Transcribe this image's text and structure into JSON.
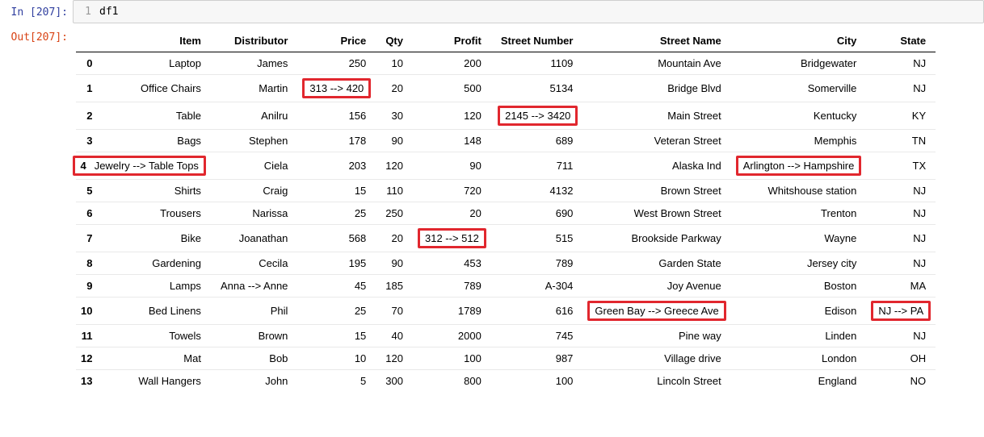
{
  "cell": {
    "in_prompt": "In [207]:",
    "out_prompt": "Out[207]:",
    "line_number": "1",
    "code": "df1"
  },
  "table": {
    "columns": [
      "Item",
      "Distributor",
      "Price",
      "Qty",
      "Profit",
      "Street Number",
      "Street Name",
      "City",
      "State"
    ],
    "rows": [
      {
        "idx": "0",
        "Item": "Laptop",
        "Distributor": "James",
        "Price": "250",
        "Qty": "10",
        "Profit": "200",
        "Street Number": "1109",
        "Street Name": "Mountain Ave",
        "City": "Bridgewater",
        "State": "NJ"
      },
      {
        "idx": "1",
        "Item": "Office Chairs",
        "Distributor": "Martin",
        "Price": "313 --> 420",
        "Qty": "20",
        "Profit": "500",
        "Street Number": "5134",
        "Street Name": "Bridge Blvd",
        "City": "Somerville",
        "State": "NJ"
      },
      {
        "idx": "2",
        "Item": "Table",
        "Distributor": "Anilru",
        "Price": "156",
        "Qty": "30",
        "Profit": "120",
        "Street Number": "2145 --> 3420",
        "Street Name": "Main Street",
        "City": "Kentucky",
        "State": "KY"
      },
      {
        "idx": "3",
        "Item": "Bags",
        "Distributor": "Stephen",
        "Price": "178",
        "Qty": "90",
        "Profit": "148",
        "Street Number": "689",
        "Street Name": "Veteran Street",
        "City": "Memphis",
        "State": "TN"
      },
      {
        "idx": "4",
        "Item": "Jewelry --> Table Tops",
        "Distributor": "Ciela",
        "Price": "203",
        "Qty": "120",
        "Profit": "90",
        "Street Number": "711",
        "Street Name": "Alaska Ind",
        "City": "Arlington --> Hampshire",
        "State": "TX"
      },
      {
        "idx": "5",
        "Item": "Shirts",
        "Distributor": "Craig",
        "Price": "15",
        "Qty": "110",
        "Profit": "720",
        "Street Number": "4132",
        "Street Name": "Brown Street",
        "City": "Whitshouse station",
        "State": "NJ"
      },
      {
        "idx": "6",
        "Item": "Trousers",
        "Distributor": "Narissa",
        "Price": "25",
        "Qty": "250",
        "Profit": "20",
        "Street Number": "690",
        "Street Name": "West Brown Street",
        "City": "Trenton",
        "State": "NJ"
      },
      {
        "idx": "7",
        "Item": "Bike",
        "Distributor": "Joanathan",
        "Price": "568",
        "Qty": "20",
        "Profit": "312 --> 512",
        "Street Number": "515",
        "Street Name": "Brookside Parkway",
        "City": "Wayne",
        "State": "NJ"
      },
      {
        "idx": "8",
        "Item": "Gardening",
        "Distributor": "Cecila",
        "Price": "195",
        "Qty": "90",
        "Profit": "453",
        "Street Number": "789",
        "Street Name": "Garden State",
        "City": "Jersey city",
        "State": "NJ"
      },
      {
        "idx": "9",
        "Item": "Lamps",
        "Distributor": "Anna --> Anne",
        "Price": "45",
        "Qty": "185",
        "Profit": "789",
        "Street Number": "A-304",
        "Street Name": "Joy Avenue",
        "City": "Boston",
        "State": "MA"
      },
      {
        "idx": "10",
        "Item": "Bed Linens",
        "Distributor": "Phil",
        "Price": "25",
        "Qty": "70",
        "Profit": "1789",
        "Street Number": "616",
        "Street Name": "Green Bay --> Greece Ave",
        "City": "Edison",
        "State": "NJ --> PA"
      },
      {
        "idx": "11",
        "Item": "Towels",
        "Distributor": "Brown",
        "Price": "15",
        "Qty": "40",
        "Profit": "2000",
        "Street Number": "745",
        "Street Name": "Pine way",
        "City": "Linden",
        "State": "NJ"
      },
      {
        "idx": "12",
        "Item": "Mat",
        "Distributor": "Bob",
        "Price": "10",
        "Qty": "120",
        "Profit": "100",
        "Street Number": "987",
        "Street Name": "Village drive",
        "City": "London",
        "State": "OH"
      },
      {
        "idx": "13",
        "Item": "Wall Hangers",
        "Distributor": "John",
        "Price": "5",
        "Qty": "300",
        "Profit": "800",
        "Street Number": "100",
        "Street Name": "Lincoln Street",
        "City": "England",
        "State": "NO"
      }
    ],
    "highlights": [
      {
        "row_idx": "1",
        "column": "Price"
      },
      {
        "row_idx": "2",
        "column": "Street Number"
      },
      {
        "row_idx": "4",
        "column": "Item",
        "wrap_index": true
      },
      {
        "row_idx": "4",
        "column": "City"
      },
      {
        "row_idx": "7",
        "column": "Profit"
      },
      {
        "row_idx": "10",
        "column": "Street Name"
      },
      {
        "row_idx": "10",
        "column": "State"
      }
    ]
  }
}
